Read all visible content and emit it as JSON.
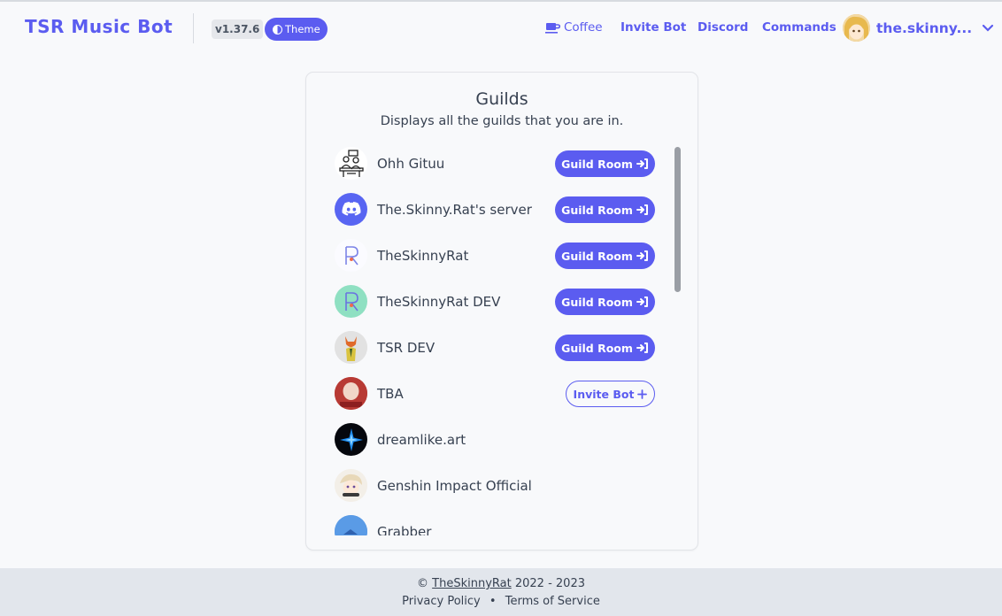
{
  "header": {
    "brand": "TSR Music Bot",
    "version": "v1.37.6",
    "theme_label": "Theme",
    "nav": {
      "coffee": "Coffee",
      "invite_bot": "Invite Bot",
      "discord": "Discord",
      "commands": "Commands"
    },
    "user": {
      "name": "the.skinny...",
      "avatar": "anime-avatar"
    }
  },
  "guilds": {
    "title": "Guilds",
    "subtitle": "Displays all the guilds that you are in.",
    "room_label": "Guild Room",
    "invite_label": "Invite Bot",
    "items": [
      {
        "name": "Ohh Gituu",
        "action": "room",
        "icon": "people-icon"
      },
      {
        "name": "The.Skinny.Rat's server",
        "action": "room",
        "icon": "discord-icon"
      },
      {
        "name": "TheSkinnyRat",
        "action": "room",
        "icon": "r-logo-icon"
      },
      {
        "name": "TheSkinnyRat DEV",
        "action": "room",
        "icon": "r-logo-dev-icon"
      },
      {
        "name": "TSR DEV",
        "action": "room",
        "icon": "fox-avatar"
      },
      {
        "name": "TBA",
        "action": "invite",
        "icon": "photo-avatar"
      },
      {
        "name": "dreamlike.art",
        "action": "none",
        "icon": "star-icon"
      },
      {
        "name": "Genshin Impact Official",
        "action": "none",
        "icon": "anime-avatar"
      },
      {
        "name": "Grabber",
        "action": "none",
        "icon": "sky-avatar"
      }
    ]
  },
  "footer": {
    "copyright_prefix": "©",
    "owner": "TheSkinnyRat",
    "years": "2022 - 2023",
    "privacy": "Privacy Policy",
    "separator": "•",
    "terms": "Terms of Service"
  },
  "colors": {
    "accent": "#5b5cf0",
    "background": "#f8f9fb",
    "footer": "#e2e6ec",
    "discord": "#5865f2"
  }
}
